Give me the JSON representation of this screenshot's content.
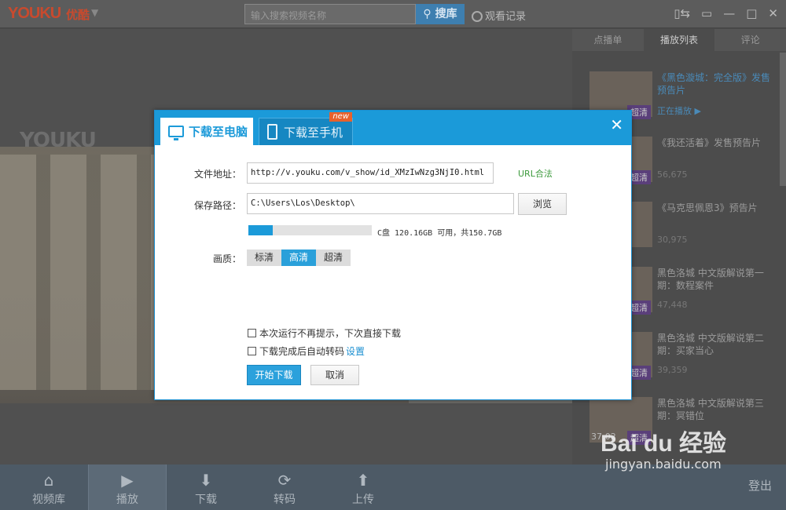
{
  "topbar": {
    "logo_text": "YOUKU",
    "logo_cn": "优酷",
    "search_placeholder": "输入搜索视频名称",
    "search_button": "搜库",
    "history_label": "观看记录"
  },
  "right_panel": {
    "tabs": [
      "点播单",
      "播放列表",
      "评论"
    ],
    "items": [
      {
        "title": "《黑色漩城：完全版》发售预告片",
        "sub": "正在播放 ▶",
        "badge": "超清",
        "duration": "",
        "active": true
      },
      {
        "title": "《我还活着》发售预告片",
        "sub": "56,675",
        "badge": "超清",
        "duration": "",
        "active": false
      },
      {
        "title": "《马克思佩恩3》预告片",
        "sub": "30,975",
        "badge": "",
        "duration": "",
        "active": false
      },
      {
        "title": "黑色洛城 中文版解说第一期：数程案件",
        "sub": "47,448",
        "badge": "超清",
        "duration": "",
        "active": false
      },
      {
        "title": "黑色洛城 中文版解说第二期：买家当心",
        "sub": "39,359",
        "badge": "超清",
        "duration": "",
        "active": false
      },
      {
        "title": "黑色洛城 中文版解说第三期：冥错位",
        "sub": "",
        "badge": "超清",
        "duration": "37:02",
        "active": false
      }
    ]
  },
  "bottombar": {
    "items": [
      "视频库",
      "播放",
      "下载",
      "转码",
      "上传"
    ],
    "logout": "登出"
  },
  "watermark": {
    "main": "Bai du 经验",
    "url": "jingyan.baidu.com"
  },
  "video": {
    "logo": "YOUKU"
  },
  "dialog": {
    "tab_pc": "下载至电脑",
    "tab_phone": "下载至手机",
    "new_badge": "new",
    "close_symbol": "✕",
    "file_address_label": "文件地址：",
    "file_address_value": "http://v.youku.com/v_show/id_XMzIwNzg3NjI0.html",
    "url_link": "URL合法",
    "save_path_label": "保存路径：",
    "save_path_value": "C:\\Users\\Los\\Desktop\\",
    "browse_button": "浏览",
    "disk_used_fraction": 0.2,
    "disk_text": "C盘 120.16GB 可用，共150.7GB",
    "quality_label": "画质：",
    "quality_options": [
      "标清",
      "高清",
      "超清"
    ],
    "quality_selected": "高清",
    "check1_label": "本次运行不再提示，下次直接下载",
    "check2_label": "下载完成后自动转码",
    "settings_link": "设置",
    "start_button": "开始下载",
    "cancel_button": "取消"
  },
  "colors": {
    "accent": "#1b9ad9",
    "link_green": "#3c9a3c"
  }
}
